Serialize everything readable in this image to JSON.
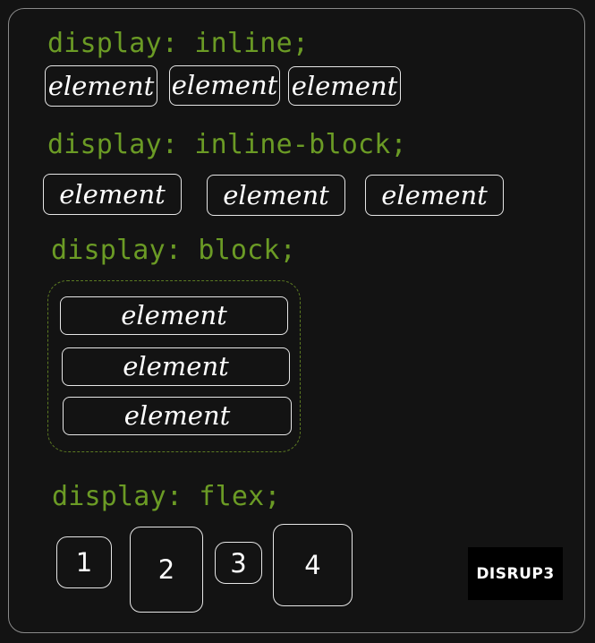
{
  "sections": {
    "inline": {
      "heading": "display: inline;",
      "items": [
        "element",
        "element",
        "element"
      ]
    },
    "inline_block": {
      "heading": "display: inline-block;",
      "items": [
        "element",
        "element",
        "element"
      ]
    },
    "block": {
      "heading": "display: block;",
      "items": [
        "element",
        "element",
        "element"
      ]
    },
    "flex": {
      "heading": "display: flex;",
      "items": [
        "1",
        "2",
        "3",
        "4"
      ]
    }
  },
  "logo": "DISRUP3",
  "colors": {
    "background": "#131313",
    "heading_green": "#6b9b25",
    "box_border": "#e6e6e6",
    "dashed_border": "#5c7a22"
  }
}
